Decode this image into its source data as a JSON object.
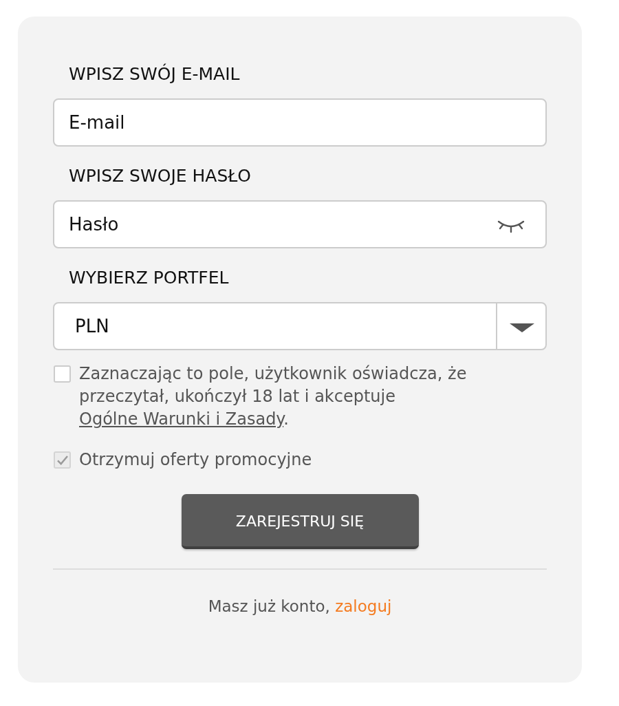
{
  "fields": [
    {
      "kind": "text",
      "label": "WPISZ SWÓJ E-MAIL",
      "placeholder": "E-mail"
    },
    {
      "kind": "password",
      "label": "WPISZ SWOJE HASŁO",
      "placeholder": "Hasło"
    },
    {
      "kind": "select",
      "label": "WYBIERZ PORTFEL",
      "value": "PLN"
    }
  ],
  "checkboxes": [
    {
      "text": "Zaznaczając to pole, użytkownik oświadcza, że przeczytał, ukończył 18 lat i akceptuje ",
      "link": "Ogólne Warunki i Zasady",
      "after": ".",
      "checked": false,
      "disabled": false
    },
    {
      "text": "Otrzymuj oferty promocyjne",
      "checked": true,
      "disabled": true
    }
  ],
  "submit_button": "ZAREJESTRUJ SIĘ",
  "footer": {
    "text": "Masz już konto,",
    "link": "zaloguj"
  }
}
